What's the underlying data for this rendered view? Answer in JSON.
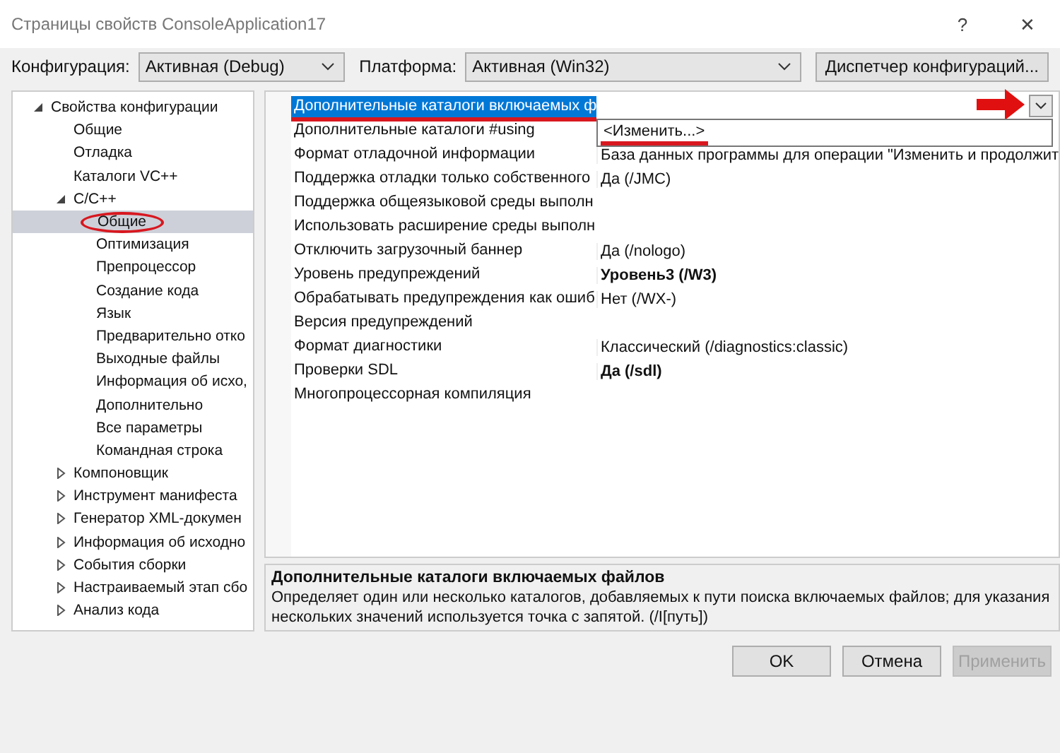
{
  "window": {
    "title": "Страницы свойств ConsoleApplication17",
    "help": "?",
    "close": "✕"
  },
  "toolbar": {
    "configuration": {
      "label": "Конфигурация:",
      "value": "Активная (Debug)"
    },
    "platform": {
      "label": "Платформа:",
      "value": "Активная (Win32)"
    },
    "manager_button": "Диспетчер конфигураций..."
  },
  "tree": [
    {
      "label": "Свойства конфигурации",
      "expanded": true,
      "selected": false,
      "children": [
        {
          "label": "Общие",
          "selected": false
        },
        {
          "label": "Отладка",
          "selected": false
        },
        {
          "label": "Каталоги VC++",
          "selected": false
        },
        {
          "label": "C/C++",
          "expanded": true,
          "selected": false,
          "children": [
            {
              "label": "Общие",
              "selected": true,
              "marked": true
            },
            {
              "label": "Оптимизация",
              "selected": false
            },
            {
              "label": "Препроцессор",
              "selected": false
            },
            {
              "label": "Создание кода",
              "selected": false
            },
            {
              "label": "Язык",
              "selected": false
            },
            {
              "label": "Предварительно отко",
              "selected": false
            },
            {
              "label": "Выходные файлы",
              "selected": false
            },
            {
              "label": "Информация об исхо,",
              "selected": false
            },
            {
              "label": "Дополнительно",
              "selected": false
            },
            {
              "label": "Все параметры",
              "selected": false
            },
            {
              "label": "Командная строка",
              "selected": false
            }
          ]
        },
        {
          "label": "Компоновщик",
          "expanded": false,
          "selected": false
        },
        {
          "label": "Инструмент манифеста",
          "expanded": false,
          "selected": false
        },
        {
          "label": "Генератор XML-докумен",
          "expanded": false,
          "selected": false
        },
        {
          "label": "Информация об исходно",
          "expanded": false,
          "selected": false
        },
        {
          "label": "События сборки",
          "expanded": false,
          "selected": false
        },
        {
          "label": "Настраиваемый этап сбо",
          "expanded": false,
          "selected": false
        },
        {
          "label": "Анализ кода",
          "expanded": false,
          "selected": false
        }
      ]
    }
  ],
  "properties": [
    {
      "name": "Дополнительные каталоги включаемых ф",
      "selected": true,
      "marked": true
    },
    {
      "name": "Дополнительные каталоги #using",
      "selected": false
    },
    {
      "name": "Формат отладочной информации",
      "value": "База данных программы для операции \"Изменить и продолжит",
      "selected": false,
      "bold": false
    },
    {
      "name": "Поддержка отладки только собственного",
      "value": "Да (/JMC)",
      "selected": false,
      "bold": false
    },
    {
      "name": "Поддержка общеязыковой среды выполн",
      "selected": false
    },
    {
      "name": "Использовать расширение среды выполн",
      "selected": false
    },
    {
      "name": "Отключить загрузочный баннер",
      "value": "Да (/nologo)",
      "selected": false,
      "bold": false
    },
    {
      "name": "Уровень предупреждений",
      "value": "Уровень3 (/W3)",
      "selected": false,
      "bold": true
    },
    {
      "name": "Обрабатывать предупреждения как ошиб",
      "value": "Нет (/WX-)",
      "selected": false,
      "bold": false
    },
    {
      "name": "Версия предупреждений",
      "selected": false
    },
    {
      "name": "Формат диагностики",
      "value": "Классический (/diagnostics:classic)",
      "selected": false,
      "bold": false
    },
    {
      "name": "Проверки SDL",
      "value": "Да (/sdl)",
      "selected": false,
      "bold": true
    },
    {
      "name": "Многопроцессорная компиляция",
      "selected": false
    }
  ],
  "dropdown": {
    "options": [
      {
        "label": "<Изменить...>",
        "marked": true
      }
    ],
    "arrow_marked": true
  },
  "description": {
    "title": "Дополнительные каталоги включаемых файлов",
    "text": "Определяет один или несколько каталогов, добавляемых к пути поиска включаемых файлов; для указания нескольких значений используется точка с запятой.     (/I[путь])"
  },
  "buttons": [
    {
      "label": "OK",
      "disabled": false
    },
    {
      "label": "Отмена",
      "disabled": false
    },
    {
      "label": "Применить",
      "disabled": true
    }
  ]
}
